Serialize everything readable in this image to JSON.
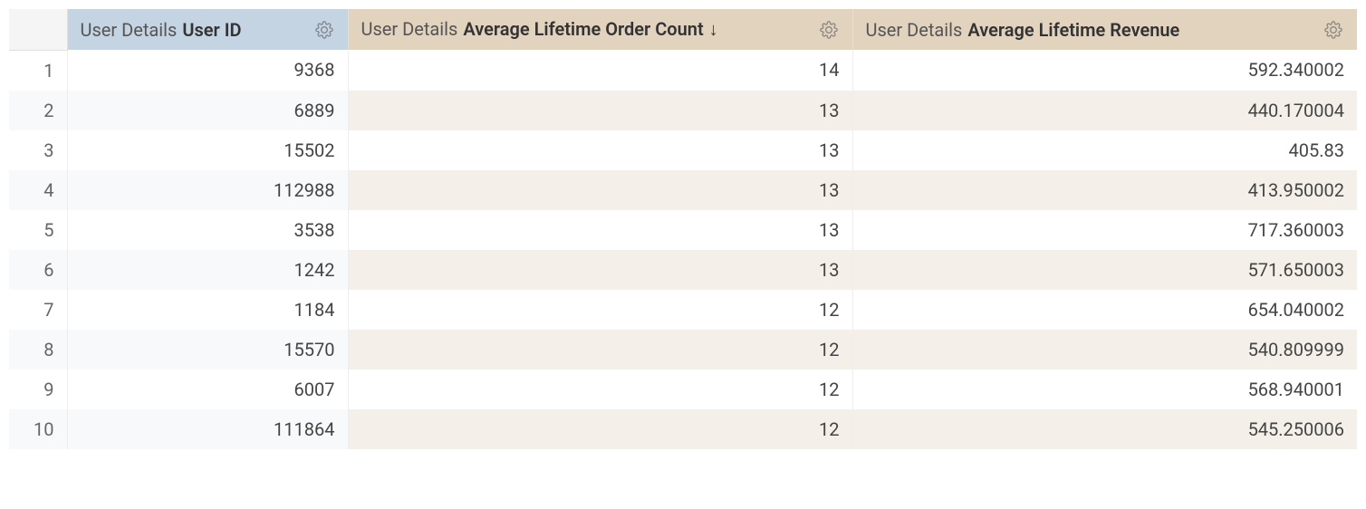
{
  "columns": {
    "col0": {
      "prefix": "User Details",
      "field": "User ID",
      "sorted": false
    },
    "col1": {
      "prefix": "User Details",
      "field": "Average Lifetime Order Count",
      "sorted": true,
      "sort_arrow": "↓"
    },
    "col2": {
      "prefix": "User Details",
      "field": "Average Lifetime Revenue",
      "sorted": false
    }
  },
  "rows": [
    {
      "n": "1",
      "c0": "9368",
      "c1": "14",
      "c2": "592.340002"
    },
    {
      "n": "2",
      "c0": "6889",
      "c1": "13",
      "c2": "440.170004"
    },
    {
      "n": "3",
      "c0": "15502",
      "c1": "13",
      "c2": "405.83"
    },
    {
      "n": "4",
      "c0": "112988",
      "c1": "13",
      "c2": "413.950002"
    },
    {
      "n": "5",
      "c0": "3538",
      "c1": "13",
      "c2": "717.360003"
    },
    {
      "n": "6",
      "c0": "1242",
      "c1": "13",
      "c2": "571.650003"
    },
    {
      "n": "7",
      "c0": "1184",
      "c1": "12",
      "c2": "654.040002"
    },
    {
      "n": "8",
      "c0": "15570",
      "c1": "12",
      "c2": "540.809999"
    },
    {
      "n": "9",
      "c0": "6007",
      "c1": "12",
      "c2": "568.940001"
    },
    {
      "n": "10",
      "c0": "111864",
      "c1": "12",
      "c2": "545.250006"
    }
  ],
  "chart_data": {
    "type": "table",
    "columns": [
      "User Details User ID",
      "User Details Average Lifetime Order Count",
      "User Details Average Lifetime Revenue"
    ],
    "rows": [
      [
        9368,
        14,
        592.340002
      ],
      [
        6889,
        13,
        440.170004
      ],
      [
        15502,
        13,
        405.83
      ],
      [
        112988,
        13,
        413.950002
      ],
      [
        3538,
        13,
        717.360003
      ],
      [
        1242,
        13,
        571.650003
      ],
      [
        1184,
        12,
        654.040002
      ],
      [
        15570,
        12,
        540.809999
      ],
      [
        6007,
        12,
        568.940001
      ],
      [
        111864,
        12,
        545.250006
      ]
    ],
    "sort": {
      "column": 1,
      "direction": "desc"
    }
  }
}
